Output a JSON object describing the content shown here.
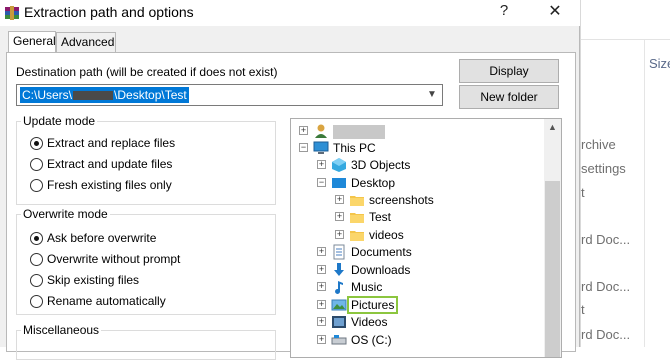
{
  "window": {
    "title": "Extraction path and options",
    "help": "?",
    "close": "✕"
  },
  "tabs": [
    {
      "label": "General",
      "active": true
    },
    {
      "label": "Advanced",
      "active": false
    }
  ],
  "destination": {
    "label": "Destination path (will be created if does not exist)",
    "path_prefix": "C:\\Users\\",
    "path_suffix": "\\Desktop\\Test"
  },
  "buttons": {
    "display": "Display",
    "new_folder": "New folder"
  },
  "update_mode": {
    "title": "Update mode",
    "options": [
      {
        "label": "Extract and replace files",
        "selected": true
      },
      {
        "label": "Extract and update files",
        "selected": false
      },
      {
        "label": "Fresh existing files only",
        "selected": false
      }
    ]
  },
  "overwrite_mode": {
    "title": "Overwrite mode",
    "options": [
      {
        "label": "Ask before overwrite",
        "selected": true
      },
      {
        "label": "Overwrite without prompt",
        "selected": false
      },
      {
        "label": "Skip existing files",
        "selected": false
      },
      {
        "label": "Rename automatically",
        "selected": false
      }
    ]
  },
  "misc": {
    "title": "Miscellaneous"
  },
  "tree": {
    "items": [
      {
        "label": "",
        "icon": "user-icon",
        "expander": "+"
      },
      {
        "label": "This PC",
        "icon": "computer-icon",
        "expander": "−"
      },
      {
        "label": "3D Objects",
        "icon": "3d-objects-icon",
        "expander": "+"
      },
      {
        "label": "Desktop",
        "icon": "desktop-icon",
        "expander": "−"
      },
      {
        "label": "screenshots",
        "icon": "folder-icon",
        "expander": "+"
      },
      {
        "label": "Test",
        "icon": "folder-icon",
        "expander": "+"
      },
      {
        "label": "videos",
        "icon": "folder-icon",
        "expander": "+"
      },
      {
        "label": "Documents",
        "icon": "documents-icon",
        "expander": "+"
      },
      {
        "label": "Downloads",
        "icon": "downloads-icon",
        "expander": "+"
      },
      {
        "label": "Music",
        "icon": "music-icon",
        "expander": "+"
      },
      {
        "label": "Pictures",
        "icon": "pictures-icon",
        "expander": "+"
      },
      {
        "label": "Videos",
        "icon": "videos-icon",
        "expander": "+"
      },
      {
        "label": "OS (C:)",
        "icon": "drive-icon",
        "expander": "+"
      }
    ]
  },
  "background": {
    "size_header": "Size",
    "items": [
      "rchive",
      "settings",
      "t",
      "rd Doc...",
      "rd Doc...",
      "t",
      "rd Doc..."
    ]
  },
  "colors": {
    "selection": "#0078d7",
    "highlight_outline": "#8cc63f"
  }
}
